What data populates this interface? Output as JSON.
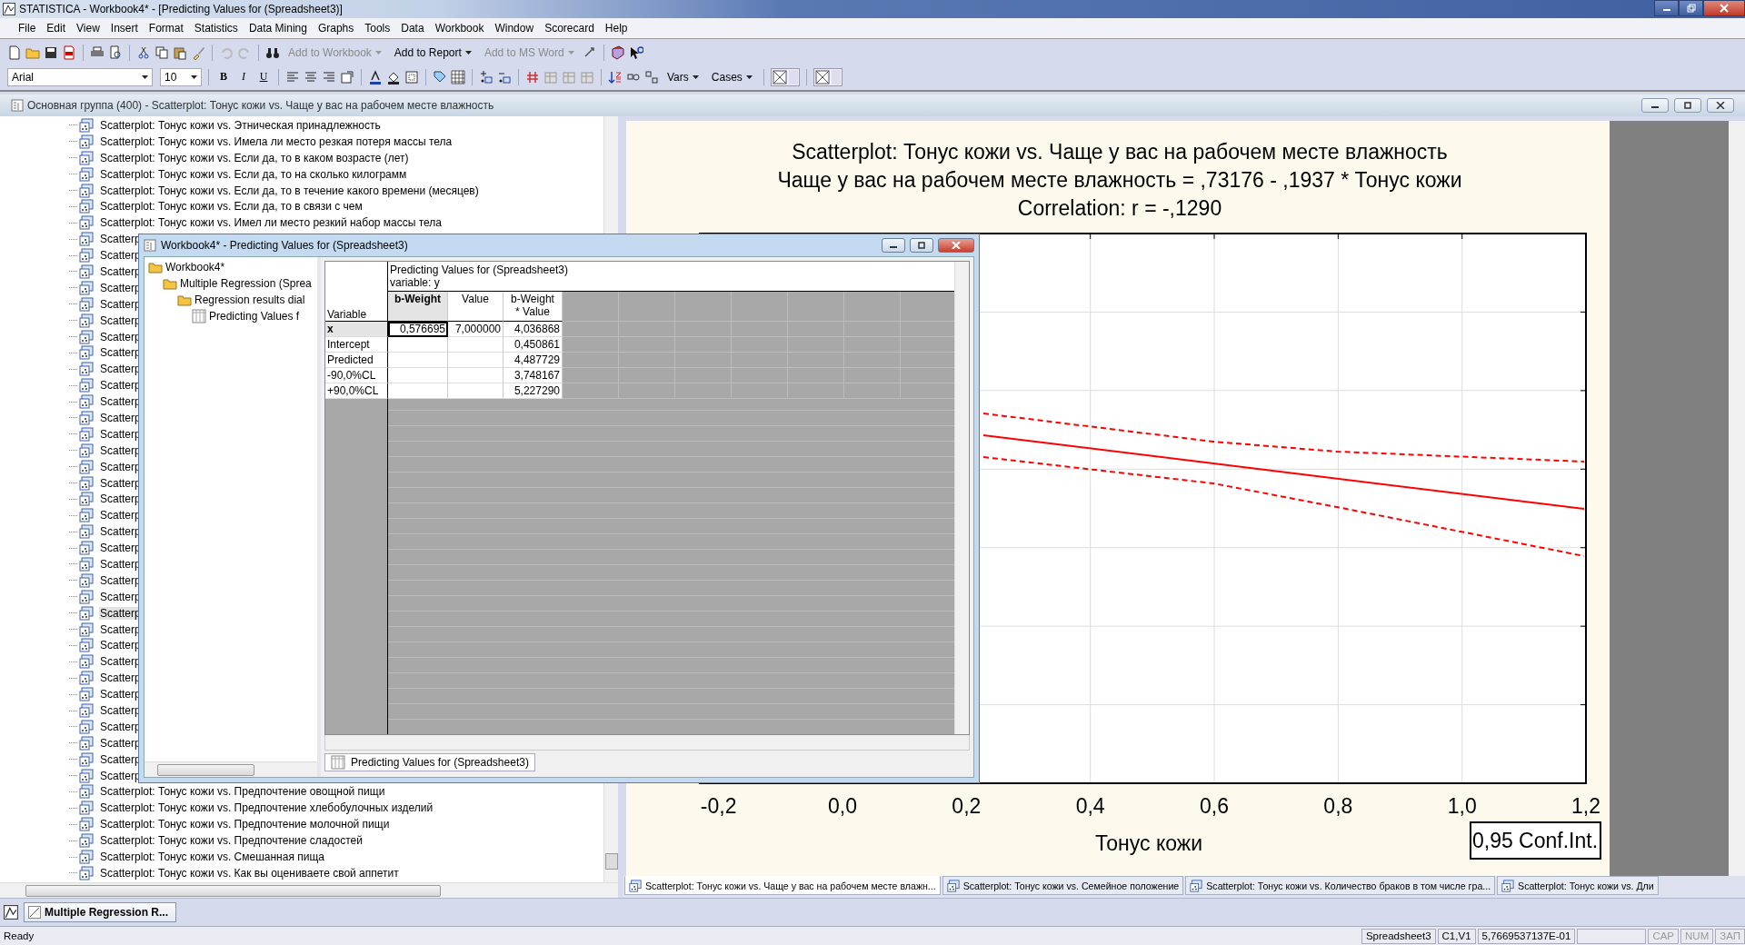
{
  "app_title": "STATISTICA - Workbook4* - [Predicting Values for (Spreadsheet3)]",
  "menu": [
    "File",
    "Edit",
    "View",
    "Insert",
    "Format",
    "Statistics",
    "Data Mining",
    "Graphs",
    "Tools",
    "Data",
    "Workbook",
    "Window",
    "Scorecard",
    "Help"
  ],
  "toolbar_buttons": [
    {
      "label": "Add to Workbook",
      "disabled": true
    },
    {
      "label": "Add to Report",
      "disabled": false
    },
    {
      "label": "Add to MS Word",
      "disabled": true
    }
  ],
  "format_bar": {
    "font": "Arial",
    "size": "10",
    "bold": "B",
    "italic": "I",
    "underline": "U",
    "vars": "Vars",
    "cases": "Cases"
  },
  "child_window": {
    "title": "Основная группа (400) - Scatterplot: Тонус кожи vs. Чаще у вас на рабочем месте влажность"
  },
  "tree": {
    "items": [
      {
        "label": "Scatterplot: Тонус кожи vs. Этническая принадлежность",
        "selected": false
      },
      {
        "label": "Scatterplot: Тонус кожи vs. Имела ли место резкая потеря массы тела",
        "selected": false
      },
      {
        "label": "Scatterplot: Тонус кожи vs. Если да, то в каком возрасте (лет)",
        "selected": false
      },
      {
        "label": "Scatterplot: Тонус кожи vs. Если да, то на сколько килограмм",
        "selected": false
      },
      {
        "label": "Scatterplot: Тонус кожи vs. Если да, то в течение какого времени (месяцев)",
        "selected": false
      },
      {
        "label": "Scatterplot: Тонус кожи vs. Если да, то в связи с чем",
        "selected": false
      },
      {
        "label": "Scatterplot: Тонус кожи vs. Имел ли место резкий набор массы тела",
        "selected": false
      },
      {
        "label": "Scatterp",
        "selected": false
      },
      {
        "label": "Scatterp",
        "selected": false
      },
      {
        "label": "Scatterp",
        "selected": false
      },
      {
        "label": "Scatterp",
        "selected": false
      },
      {
        "label": "Scatterp",
        "selected": false
      },
      {
        "label": "Scatterp",
        "selected": false
      },
      {
        "label": "Scatterp",
        "selected": false
      },
      {
        "label": "Scatterp",
        "selected": false
      },
      {
        "label": "Scatterp",
        "selected": false
      },
      {
        "label": "Scatterp",
        "selected": false
      },
      {
        "label": "Scatterp",
        "selected": false
      },
      {
        "label": "Scatterp",
        "selected": false
      },
      {
        "label": "Scatterp",
        "selected": false
      },
      {
        "label": "Scatterp",
        "selected": false
      },
      {
        "label": "Scatterp",
        "selected": false
      },
      {
        "label": "Scatterp",
        "selected": false
      },
      {
        "label": "Scatterp",
        "selected": false
      },
      {
        "label": "Scatterp",
        "selected": false
      },
      {
        "label": "Scatterp",
        "selected": false
      },
      {
        "label": "Scatterp",
        "selected": false
      },
      {
        "label": "Scatterp",
        "selected": false
      },
      {
        "label": "Scatterp",
        "selected": false
      },
      {
        "label": "Scatterp",
        "selected": false
      },
      {
        "label": "Scatterp",
        "selected": true
      },
      {
        "label": "Scatterp",
        "selected": false
      },
      {
        "label": "Scatterp",
        "selected": false
      },
      {
        "label": "Scatterp",
        "selected": false
      },
      {
        "label": "Scatterp",
        "selected": false
      },
      {
        "label": "Scatterp",
        "selected": false
      },
      {
        "label": "Scatterp",
        "selected": false
      },
      {
        "label": "Scatterp",
        "selected": false
      },
      {
        "label": "Scatterp",
        "selected": false
      },
      {
        "label": "Scatterp",
        "selected": false
      },
      {
        "label": "Scatterp",
        "selected": false
      },
      {
        "label": "Scatterplot: Тонус кожи vs. Предпочтение овощной пищи",
        "selected": false
      },
      {
        "label": "Scatterplot: Тонус кожи vs. Предпочтение хлебобулочных изделий",
        "selected": false
      },
      {
        "label": "Scatterplot: Тонус кожи vs. Предпочтение молочной пищи",
        "selected": false
      },
      {
        "label": "Scatterplot: Тонус кожи vs. Предпочтение сладостей",
        "selected": false
      },
      {
        "label": "Scatterplot: Тонус кожи vs. Смешанная пища",
        "selected": false
      },
      {
        "label": "Scatterplot: Тонус кожи vs. Как вы оцениваете свой аппетит",
        "selected": false
      }
    ]
  },
  "inner_window": {
    "title": "Workbook4* - Predicting Values for (Spreadsheet3)",
    "tree": [
      {
        "label": "Workbook4*",
        "children": [
          {
            "label": "Multiple Regression (Sprea",
            "children": [
              {
                "label": "Regression results dial",
                "children": [
                  {
                    "label": "Predicting Values f",
                    "kind": "sheet"
                  }
                ]
              }
            ]
          }
        ]
      }
    ],
    "sheet": {
      "title": "Predicting Values for (Spreadsheet3)",
      "subtitle": "variable: y",
      "corner": "Variable",
      "columns": [
        {
          "label": "b-Weight",
          "selected": true
        },
        {
          "label": "Value",
          "selected": false
        },
        {
          "label": "b-Weight\n* Value",
          "selected": false
        }
      ],
      "rows": [
        {
          "label": "x",
          "selected": true,
          "cells": [
            "0,576695",
            "7,000000",
            "4,036868"
          ]
        },
        {
          "label": "Intercept",
          "selected": false,
          "cells": [
            null,
            null,
            "0,450861"
          ]
        },
        {
          "label": "Predicted",
          "selected": false,
          "cells": [
            null,
            null,
            "4,487729"
          ]
        },
        {
          "label": "-90,0%CL",
          "selected": false,
          "cells": [
            null,
            null,
            "3,748167"
          ]
        },
        {
          "label": "+90,0%CL",
          "selected": false,
          "cells": [
            null,
            null,
            "5,227290"
          ]
        }
      ]
    },
    "tab": "Predicting Values for (Spreadsheet3)"
  },
  "chart": {
    "title_lines": [
      "Scatterplot: Тонус кожи vs. Чаще у вас на рабочем месте влажность",
      "Чаще у вас на рабочем месте влажность = ,73176 - ,1937  * Тонус кожи",
      "Correlation: r = -,1290"
    ],
    "x_tick_labels": [
      "-0,2",
      "0,0",
      "0,2",
      "0,4",
      "0,6",
      "0,8",
      "1,0",
      "1,2"
    ],
    "x_axis_title": "Тонус кожи",
    "legend": "0,95 Conf.Int."
  },
  "chart_tabs": [
    {
      "label": "Scatterplot: Тонус кожи vs. Чаще у вас на рабочем месте влажн...",
      "selected": true
    },
    {
      "label": "Scatterplot: Тонус кожи vs. Семейное положение",
      "selected": false
    },
    {
      "label": "Scatterplot: Тонус кожи vs. Количество браков в том числе гра...",
      "selected": false
    },
    {
      "label": "Scatterplot: Тонус кожи vs. Дли",
      "selected": false
    }
  ],
  "taskbar": [
    {
      "label": "Multiple Regression R..."
    }
  ],
  "status_bar": {
    "message": "Ready",
    "panes": [
      "Spreadsheet3",
      "C1,V1",
      "5,7669537137E-01"
    ],
    "indicators": [
      {
        "label": "CAP",
        "on": false
      },
      {
        "label": "NUM",
        "on": false
      },
      {
        "label": "ЗАП",
        "on": false
      }
    ]
  }
}
